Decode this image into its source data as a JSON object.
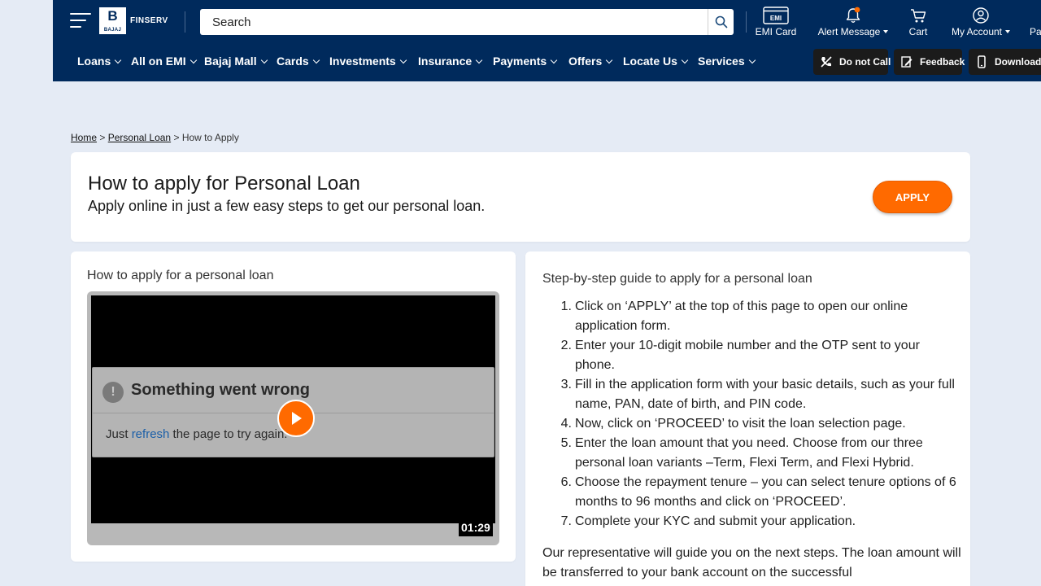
{
  "header": {
    "logo": {
      "brand": "FINSERV",
      "mark": "B",
      "sub": "BAJAJ"
    },
    "search": {
      "placeholder": "Search"
    },
    "tools": [
      {
        "id": "emi-card",
        "label": "EMI Card",
        "icon_text": "EMI",
        "icon": "emi-card-icon"
      },
      {
        "id": "alert",
        "label": "Alert Message",
        "icon": "bell-icon"
      },
      {
        "id": "cart",
        "label": "Cart",
        "icon": "cart-icon"
      },
      {
        "id": "account",
        "label": "My Account",
        "icon": "user-icon"
      },
      {
        "id": "pa",
        "label": "Pa"
      }
    ],
    "nav": [
      "Loans",
      "All on EMI",
      "Bajaj Mall",
      "Cards",
      "Investments",
      "Insurance",
      "Payments",
      "Offers",
      "Locate Us",
      "Services"
    ],
    "pills": [
      {
        "label": "Do not Call",
        "icon": "no-call-icon"
      },
      {
        "label": "Feedback",
        "icon": "feedback-icon"
      },
      {
        "label": "Download t",
        "icon": "phone-icon"
      }
    ],
    "colors": {
      "navy": "#002a5c",
      "accent": "#ff6a00",
      "alert_dot": "#ff6a00"
    }
  },
  "breadcrumb": {
    "home": "Home",
    "personal_loan": "Personal Loan",
    "current": "How to Apply",
    "separator": ">"
  },
  "title_card": {
    "title": "How to apply for Personal Loan",
    "subtitle": "Apply online in just a few easy steps to get our personal loan.",
    "apply_label": "APPLY"
  },
  "video": {
    "heading": "How to apply for a personal loan",
    "error_title": "Something went wrong",
    "error_icon": "!",
    "error_prefix": "Just ",
    "error_link": "refresh",
    "error_suffix": " the page to try again.",
    "duration": "01:29"
  },
  "steps": {
    "heading": "Step-by-step guide to apply for a personal loan",
    "items": [
      {
        "n": "1.",
        "text": "Click on ‘APPLY’ at the top of this page to open our online application form."
      },
      {
        "n": "2.",
        "text": "Enter your 10-digit mobile number and the OTP sent to your phone."
      },
      {
        "n": "3.",
        "text": "Fill in the application form with your basic details, such as your full name, PAN, date of birth, and PIN code."
      },
      {
        "n": "4.",
        "text": "Now, click on ‘PROCEED’ to visit the loan selection page."
      },
      {
        "n": "5.",
        "text": "Enter the loan amount that you need. Choose from our three personal loan variants –Term, Flexi Term, and Flexi Hybrid."
      },
      {
        "n": "6.",
        "text": "Choose the repayment tenure – you can select tenure options of 6 months to 96 months and click on ‘PROCEED’."
      },
      {
        "n": "7.",
        "text": "Complete your KYC and submit your application."
      }
    ],
    "closing": "Our representative will guide you on the next steps. The loan amount will be transferred to your bank account on the successful"
  }
}
